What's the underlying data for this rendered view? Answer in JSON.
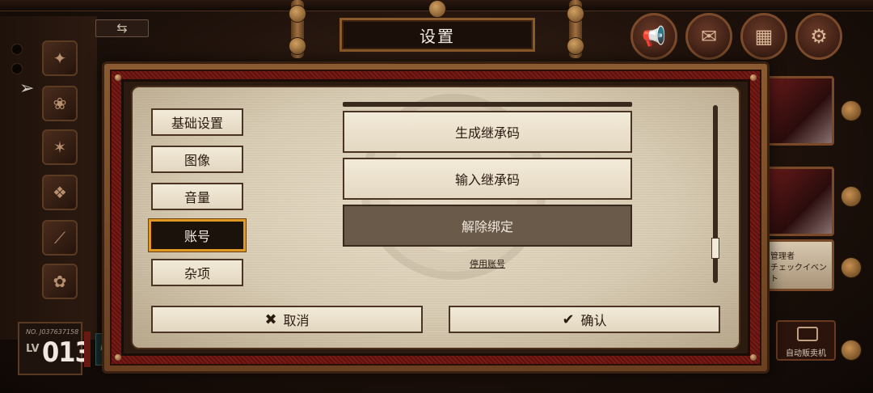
{
  "window_title": "设置",
  "tabs": [
    {
      "label": "基础设置",
      "active": false
    },
    {
      "label": "图像",
      "active": false
    },
    {
      "label": "音量",
      "active": false
    },
    {
      "label": "账号",
      "active": true
    },
    {
      "label": "杂项",
      "active": false
    }
  ],
  "account": {
    "generate_code": "生成继承码",
    "input_code": "输入继承码",
    "unbind": "解除绑定",
    "disable_account": "停用账号"
  },
  "footer": {
    "cancel_label": "取消",
    "confirm_label": "确认"
  },
  "player": {
    "id": "NO. J037637158",
    "lv_label": "LV",
    "level": "013"
  },
  "side_banner": {
    "line1": "管理者",
    "line2": "チェックイベント"
  },
  "vending_label": "自动贩卖机",
  "scroll_position": 0.8,
  "colors": {
    "active_tab_border": "#e09a24",
    "frame_red": "#7a1a14",
    "paper": "#e8ddc8",
    "disabled_button": "#6a5a4a"
  },
  "icons": {
    "cancel": "close-icon",
    "confirm": "checkmark-icon",
    "hud": [
      "megaphone-icon",
      "mail-icon",
      "shop-icon",
      "gear-icon"
    ]
  }
}
